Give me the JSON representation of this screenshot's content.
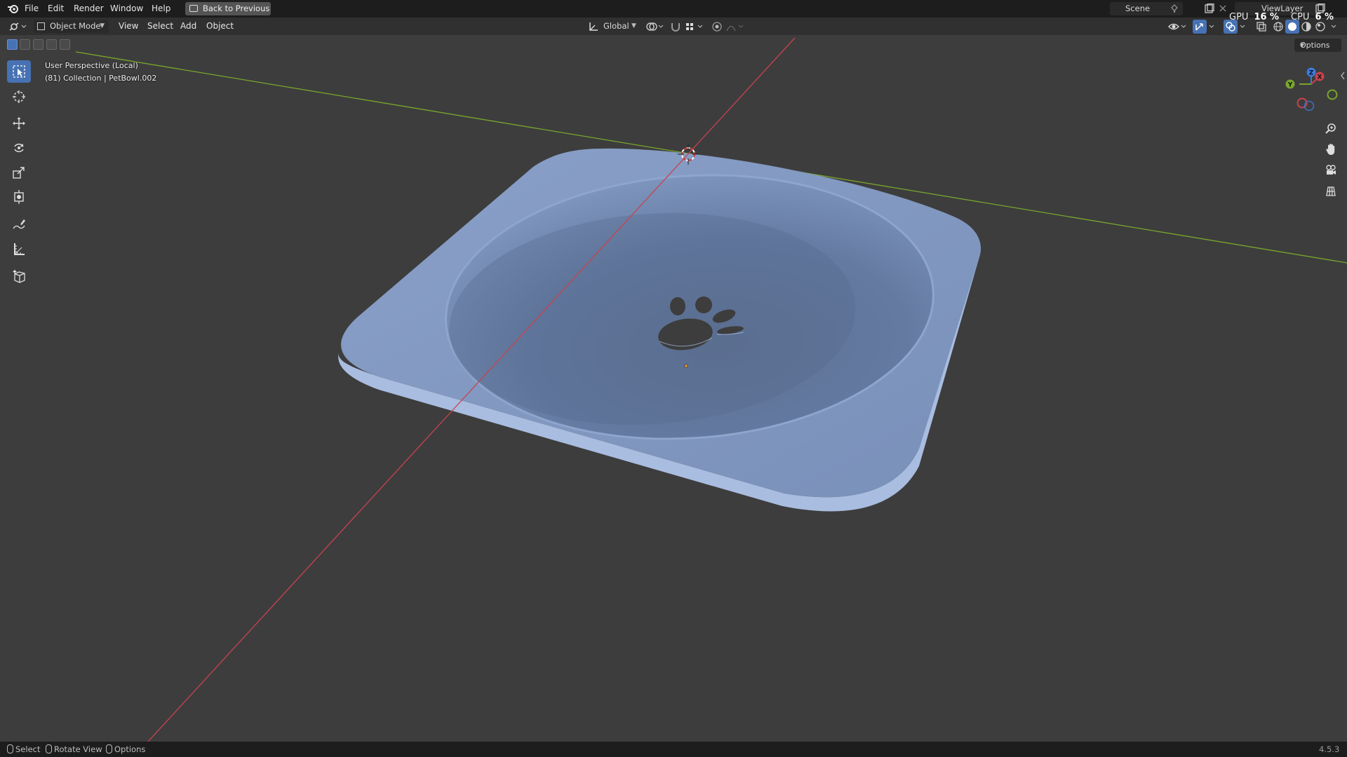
{
  "topbar": {
    "menus": [
      "File",
      "Edit",
      "Render",
      "Window",
      "Help"
    ],
    "back_button": "Back to Previous",
    "scene_name": "Scene",
    "view_layer": "ViewLayer",
    "gpu_label": "GPU",
    "gpu_value": "16 %",
    "cpu_label": "CPU",
    "cpu_value": "6 %"
  },
  "header": {
    "mode": "Object Mode",
    "menus": [
      "View",
      "Select",
      "Add",
      "Object"
    ],
    "transform_orientation": "Global",
    "options": "Options"
  },
  "viewport": {
    "perspective": "User Perspective (Local)",
    "collection_info": "(81) Collection | PetBowl.002",
    "gizmo_axes": [
      "X",
      "Y",
      "Z"
    ],
    "object_color": "#7f96bd"
  },
  "toolbar": {
    "tools": [
      "select-box",
      "cursor",
      "move",
      "rotate",
      "scale",
      "transform",
      "annotate",
      "measure",
      "add-cube"
    ],
    "active_tool": "select-box"
  },
  "statusbar": {
    "hints": [
      "Select",
      "Rotate View",
      "Options"
    ],
    "version": "4.5.3"
  },
  "colors": {
    "x_axis": "#c8434f",
    "y_axis": "#7aa62b",
    "z_axis": "#3a7ce0",
    "accent": "#4772b3"
  }
}
